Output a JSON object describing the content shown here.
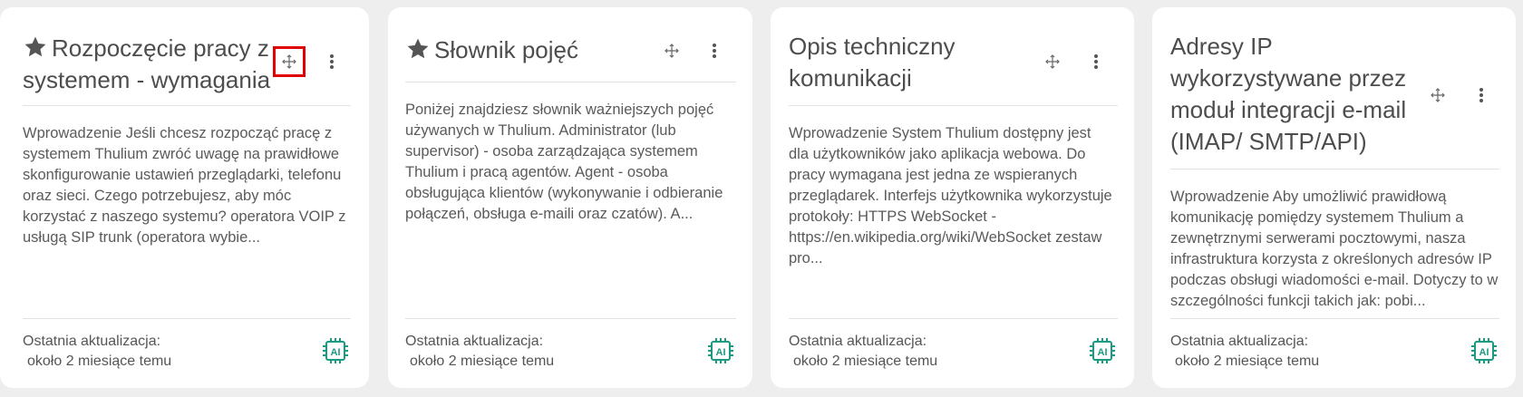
{
  "cards": [
    {
      "title_lines": [
        "Rozpoczęcie pracy z",
        "systemem - wymagania"
      ],
      "starred": true,
      "description_lines": [
        "Wprowadzenie Jeśli chcesz rozpocząć pracę z",
        "systemem Thulium zwróć uwagę na prawidłowe",
        "skonfigurowanie ustawień przeglądarki, telefonu",
        "oraz sieci. Czego potrzebujesz, aby móc",
        "korzystać z naszego systemu? operatora VOIP z",
        "usługą SIP trunk (operatora wybie..."
      ],
      "footer_label": "Ostatnia aktualizacja:",
      "footer_value": "około 2 miesiące temu"
    },
    {
      "title_lines": [
        "Słownik pojęć"
      ],
      "starred": true,
      "description_lines": [
        "Poniżej znajdziesz słownik ważniejszych pojęć",
        "używanych w Thulium. Administrator (lub",
        "supervisor) - osoba zarządzająca systemem",
        "Thulium i pracą agentów. Agent - osoba",
        "obsługująca klientów (wykonywanie i odbieranie",
        "połączeń, obsługa e-maili oraz czatów). A..."
      ],
      "footer_label": "Ostatnia aktualizacja:",
      "footer_value": "około 2 miesiące temu"
    },
    {
      "title_lines": [
        "Opis techniczny",
        "komunikacji"
      ],
      "starred": false,
      "description_lines": [
        "Wprowadzenie System Thulium dostępny jest",
        "dla użytkowników jako aplikacja webowa. Do",
        "pracy wymagana jest jedna ze wspieranych",
        "przeglądarek. Interfejs użytkownika wykorzystuje",
        "protokoły: HTTPS WebSocket -",
        "https://en.wikipedia.org/wiki/WebSocket zestaw",
        "pro..."
      ],
      "footer_label": "Ostatnia aktualizacja:",
      "footer_value": "około 2 miesiące temu"
    },
    {
      "title_lines": [
        "Adresy IP",
        "wykorzystywane przez",
        "moduł integracji e-mail",
        "(IMAP/ SMTP/API)"
      ],
      "starred": false,
      "description_lines": [
        "Wprowadzenie Aby umożliwić prawidłową",
        "komunikację pomiędzy systemem Thulium a",
        "zewnętrznymi serwerami pocztowymi, nasza",
        "infrastruktura korzysta z określonych adresów IP",
        "podczas obsługi wiadomości e-mail. Dotyczy to w",
        "szczególności funkcji takich jak: pobi..."
      ],
      "footer_label": "Ostatnia aktualizacja:",
      "footer_value": "około 2 miesiące temu"
    }
  ],
  "icons": {
    "star": "star-icon",
    "move": "move-icon",
    "more": "more-vertical-icon",
    "ai": "ai-chip-icon"
  },
  "colors": {
    "ai_badge": "#1a9a80",
    "highlight": "#e00000"
  }
}
